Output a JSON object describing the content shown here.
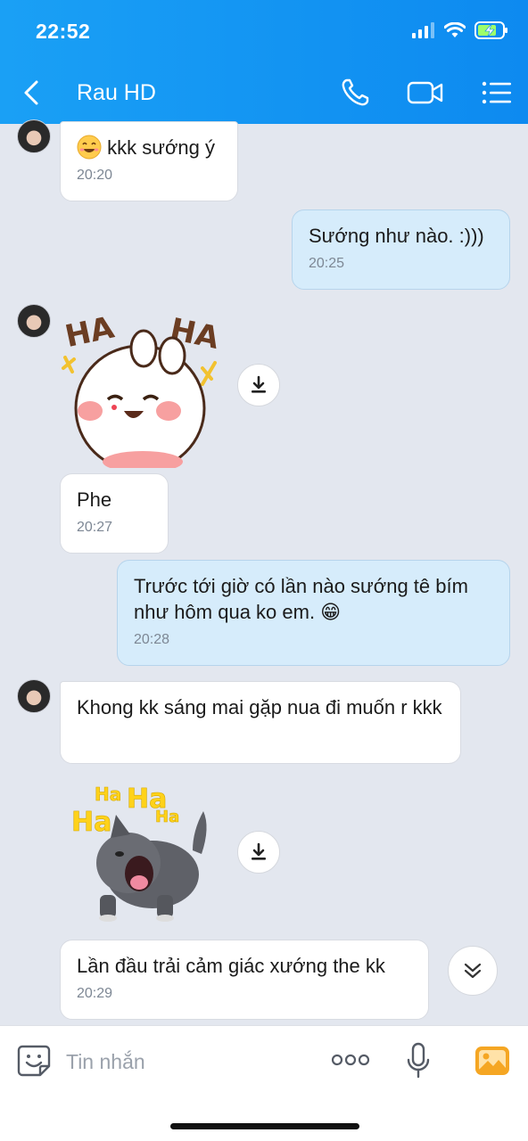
{
  "status": {
    "time": "22:52"
  },
  "header": {
    "title": "Rau HD",
    "icons": {
      "back": "chevron-left-icon",
      "call": "phone-icon",
      "video": "video-camera-icon",
      "menu": "list-menu-icon"
    }
  },
  "messages": [
    {
      "id": "m1",
      "sender": "contact",
      "text": "kkk sướng ý",
      "emoji": "laughing-sweat-emoji",
      "time": "20:20"
    },
    {
      "id": "m2",
      "sender": "me",
      "text": "Sướng như nào. :)))",
      "time": "20:25"
    },
    {
      "id": "m3",
      "sender": "contact",
      "type": "sticker",
      "sticker": "bunny-haha-sticker",
      "sticker_text": [
        "HA",
        "HA"
      ]
    },
    {
      "id": "m4",
      "sender": "contact",
      "text": "Phe",
      "time": "20:27"
    },
    {
      "id": "m5",
      "sender": "me",
      "text": "Trước tới giờ có lần nào sướng tê bím như hôm qua ko em. 😁",
      "time": "20:28"
    },
    {
      "id": "m6",
      "sender": "contact",
      "text": "Khong kk sáng mai gặp nua đi muốn r kkk"
    },
    {
      "id": "m7",
      "sender": "contact",
      "type": "sticker",
      "sticker": "laughing-dog-sticker",
      "sticker_text": [
        "Ha",
        "Ha",
        "Ha",
        "Ha"
      ]
    },
    {
      "id": "m8",
      "sender": "contact",
      "text": "Lần đầu trải cảm giác xướng the kk",
      "time": "20:29"
    }
  ],
  "composer": {
    "placeholder": "Tin nhắn",
    "icons": {
      "sticker": "smiley-sticker-icon",
      "more": "more-dots-icon",
      "mic": "microphone-icon",
      "gallery": "image-gallery-icon"
    }
  },
  "colors": {
    "header": "#0d8af0",
    "outgoing_bubble": "#d6ecfb",
    "incoming_bubble": "#ffffff",
    "background": "#e3e7ef",
    "gallery_icon": "#f5a623"
  }
}
